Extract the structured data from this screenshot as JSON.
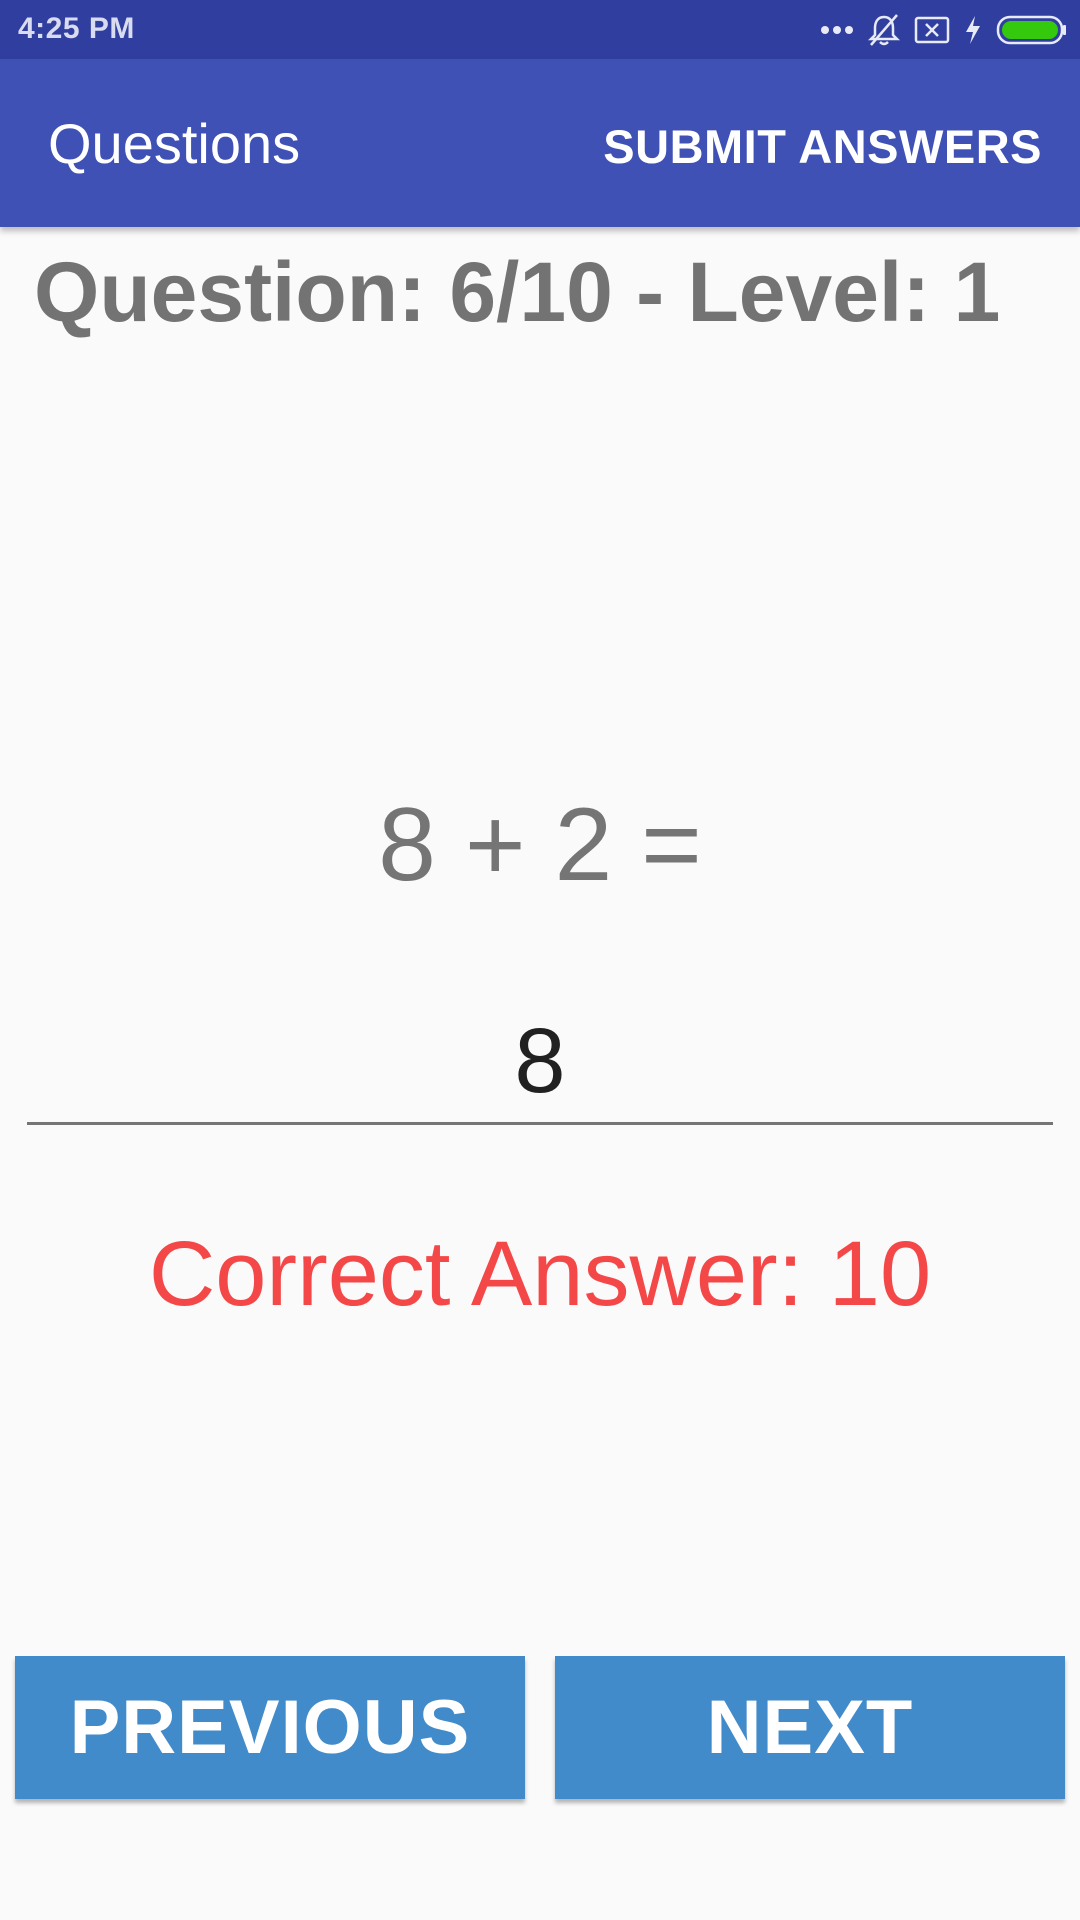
{
  "status_bar": {
    "time": "4:25 PM",
    "icons": [
      "more-dots-icon",
      "notifications-off-icon",
      "no-sim-icon",
      "charging-bolt-icon",
      "battery-full-icon"
    ],
    "battery_color": "#34c90c"
  },
  "app_bar": {
    "title": "Questions",
    "action_label": "SUBMIT ANSWERS",
    "color": "#3f51b5"
  },
  "question": {
    "header": "Question: 6/10 - Level: 1",
    "equation": "8 + 2 =",
    "answer_value": "8",
    "correct_answer": "Correct Answer: 10",
    "correct_color": "#f44848"
  },
  "buttons": {
    "previous_label": "PREVIOUS",
    "next_label": "NEXT",
    "color": "#428bca"
  }
}
